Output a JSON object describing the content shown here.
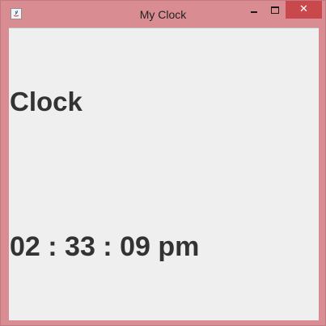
{
  "window": {
    "title": "My Clock",
    "app_icon": "java-icon",
    "controls": {
      "minimize_icon": "minimize-icon",
      "maximize_icon": "maximize-icon",
      "close_icon": "close-icon",
      "close_glyph": "✕"
    },
    "colors": {
      "frame": "#d98d92",
      "close_button": "#c9484b",
      "content_background": "#efefef",
      "text": "#333333"
    }
  },
  "content": {
    "heading": "Clock",
    "time": "02 : 33 : 09 pm"
  }
}
